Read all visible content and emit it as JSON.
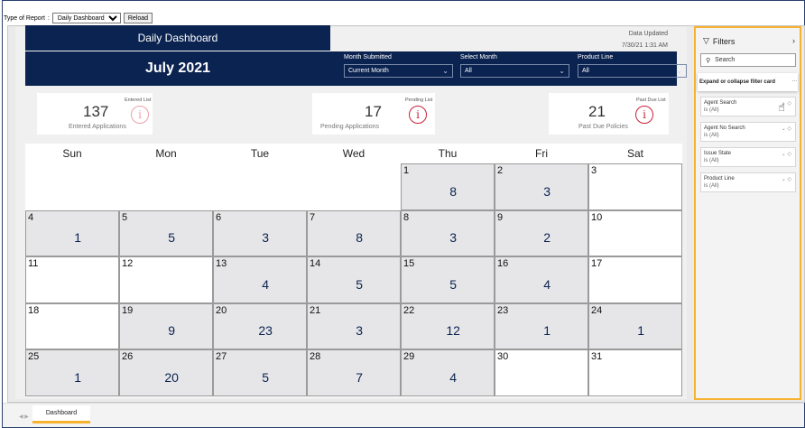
{
  "toolbar": {
    "type_label": "Type of Report",
    "report_type_selected": "Daily Dashboard",
    "reload_label": "Reload"
  },
  "header": {
    "title": "Daily Dashboard",
    "month_title": "July 2021",
    "updated_label": "Data Updated",
    "updated_value": "7/30/21 1:31 AM",
    "brand_color": "#0b2350"
  },
  "slicers": [
    {
      "label": "Month Submitted",
      "value": "Current Month"
    },
    {
      "label": "Select Month",
      "value": "All"
    },
    {
      "label": "Product Line",
      "value": "All"
    }
  ],
  "cards": [
    {
      "tag": "Entered List",
      "value": "137",
      "caption": "Entered Applications"
    },
    {
      "tag": "Pending List",
      "value": "17",
      "caption": "Pending Applications"
    },
    {
      "tag": "Past Due List",
      "value": "21",
      "caption": "Past Due Policies"
    }
  ],
  "calendar": {
    "days_of_week": [
      "Sun",
      "Mon",
      "Tue",
      "Wed",
      "Thu",
      "Fri",
      "Sat"
    ],
    "weeks": [
      [
        null,
        null,
        null,
        null,
        {
          "day": "1",
          "count": "8"
        },
        {
          "day": "2",
          "count": "3"
        },
        {
          "day": "3",
          "count": ""
        }
      ],
      [
        {
          "day": "4",
          "count": "1"
        },
        {
          "day": "5",
          "count": "5"
        },
        {
          "day": "6",
          "count": "3"
        },
        {
          "day": "7",
          "count": "8"
        },
        {
          "day": "8",
          "count": "3"
        },
        {
          "day": "9",
          "count": "2"
        },
        {
          "day": "10",
          "count": ""
        }
      ],
      [
        {
          "day": "11",
          "count": ""
        },
        {
          "day": "12",
          "count": ""
        },
        {
          "day": "13",
          "count": "4"
        },
        {
          "day": "14",
          "count": "5"
        },
        {
          "day": "15",
          "count": "5"
        },
        {
          "day": "16",
          "count": "4"
        },
        {
          "day": "17",
          "count": ""
        }
      ],
      [
        {
          "day": "18",
          "count": ""
        },
        {
          "day": "19",
          "count": "9"
        },
        {
          "day": "20",
          "count": "23"
        },
        {
          "day": "21",
          "count": "3"
        },
        {
          "day": "22",
          "count": "12"
        },
        {
          "day": "23",
          "count": "1"
        },
        {
          "day": "24",
          "count": "1"
        }
      ],
      [
        {
          "day": "25",
          "count": "1"
        },
        {
          "day": "26",
          "count": "20"
        },
        {
          "day": "27",
          "count": "5"
        },
        {
          "day": "28",
          "count": "7"
        },
        {
          "day": "29",
          "count": "4"
        },
        {
          "day": "30",
          "count": ""
        },
        {
          "day": "31",
          "count": ""
        }
      ]
    ]
  },
  "filters_pane": {
    "title": "Filters",
    "search_placeholder": "Search",
    "tooltip": "Expand or collapse filter card",
    "accent_color": "#f7b22f",
    "cards": [
      {
        "name": "Agent Search",
        "value": "is (All)"
      },
      {
        "name": "Agent No Search",
        "value": "is (All)"
      },
      {
        "name": "Issue State",
        "value": "is (All)"
      },
      {
        "name": "Product Line",
        "value": "is (All)"
      }
    ]
  },
  "tabs": [
    {
      "label": "Dashboard",
      "active": true
    }
  ]
}
